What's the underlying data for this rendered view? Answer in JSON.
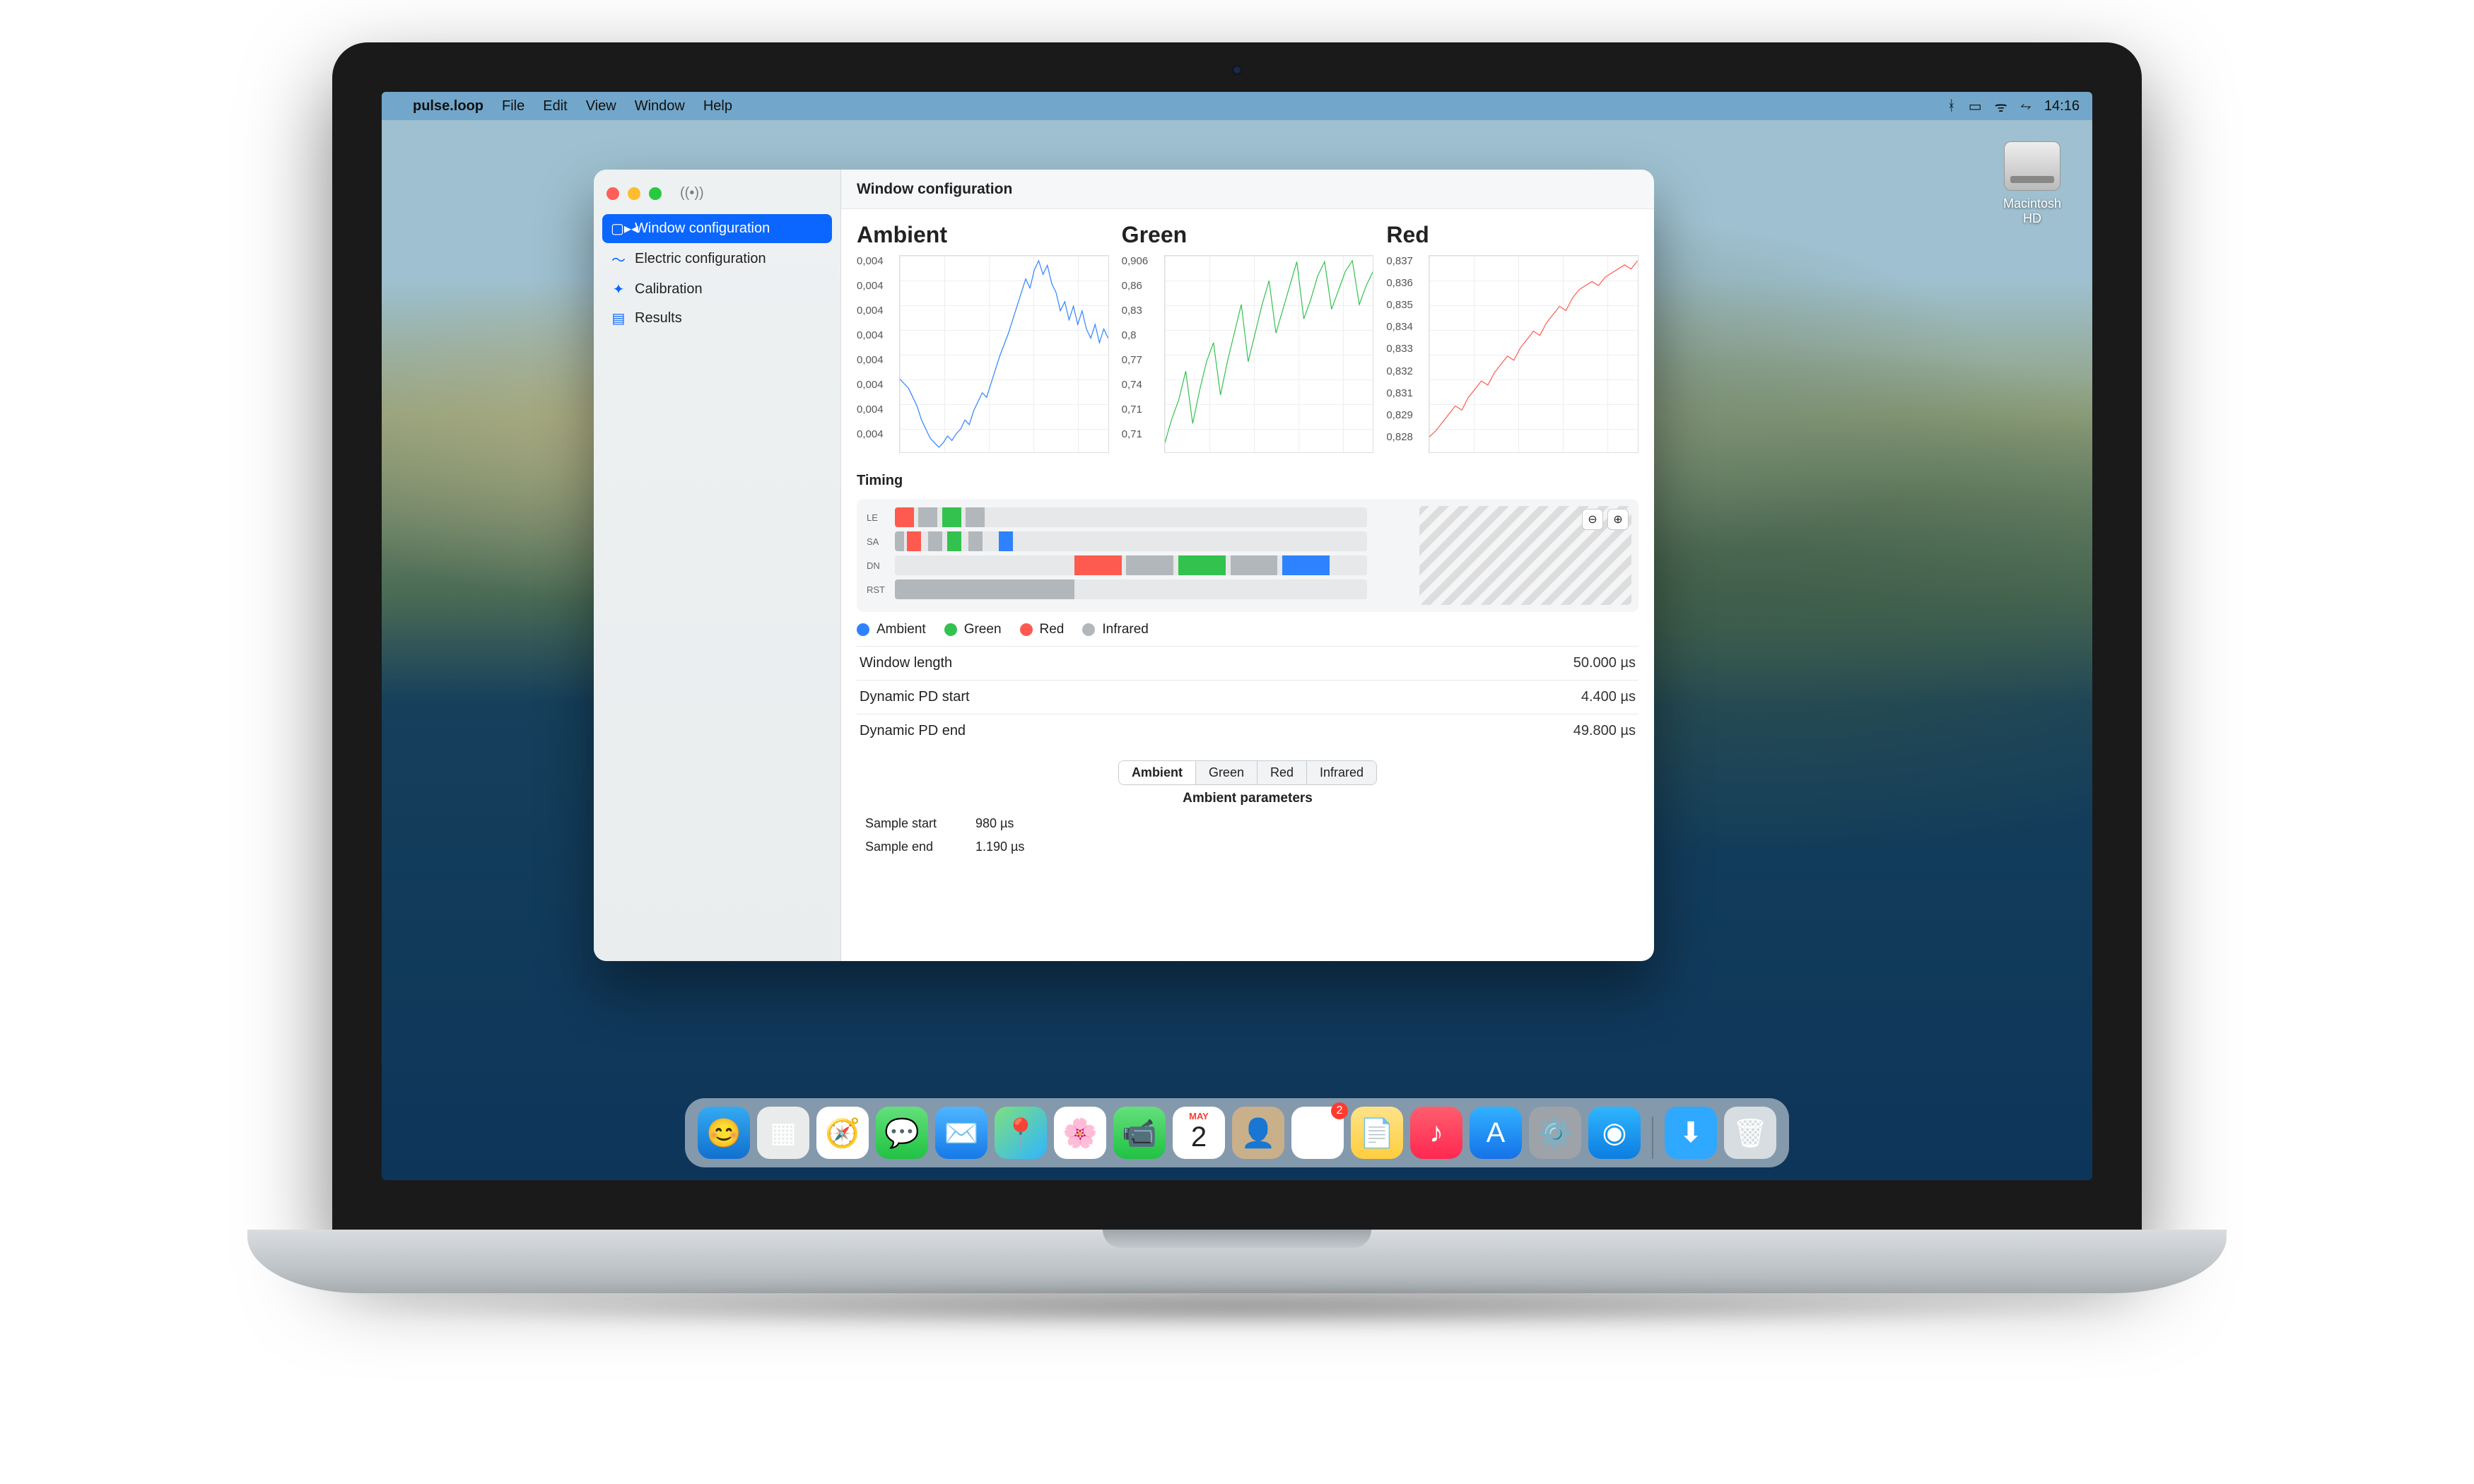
{
  "menubar": {
    "app_name": "pulse.loop",
    "items": [
      "File",
      "Edit",
      "View",
      "Window",
      "Help"
    ],
    "clock": "14:16"
  },
  "desktop": {
    "drive_label": "Macintosh HD"
  },
  "window": {
    "title": "Window configuration"
  },
  "sidebar": {
    "items": [
      {
        "label": "Window configuration",
        "selected": true
      },
      {
        "label": "Electric configuration",
        "selected": false
      },
      {
        "label": "Calibration",
        "selected": false
      },
      {
        "label": "Results",
        "selected": false
      }
    ]
  },
  "charts": {
    "ambient": {
      "title": "Ambient"
    },
    "green": {
      "title": "Green"
    },
    "red": {
      "title": "Red"
    }
  },
  "chart_data": [
    {
      "type": "line",
      "title": "Ambient",
      "color": "#2f82ff",
      "y_ticks": [
        "0,004",
        "0,004",
        "0,004",
        "0,004",
        "0,004",
        "0,004",
        "0,004",
        "0,004"
      ],
      "series": [
        {
          "name": "Ambient",
          "values": [
            0.4,
            0.38,
            0.36,
            0.32,
            0.28,
            0.22,
            0.18,
            0.14,
            0.12,
            0.1,
            0.12,
            0.15,
            0.13,
            0.16,
            0.18,
            0.22,
            0.2,
            0.26,
            0.3,
            0.34,
            0.32,
            0.38,
            0.44,
            0.5,
            0.55,
            0.6,
            0.66,
            0.72,
            0.78,
            0.84,
            0.8,
            0.88,
            0.92,
            0.86,
            0.9,
            0.82,
            0.78,
            0.7,
            0.74,
            0.66,
            0.72,
            0.64,
            0.7,
            0.62,
            0.58,
            0.64,
            0.56,
            0.62,
            0.58
          ]
        }
      ]
    },
    {
      "type": "line",
      "title": "Green",
      "color": "#33c24d",
      "y_ticks": [
        "0,906",
        "0,86",
        "0,83",
        "0,8",
        "0,77",
        "0,74",
        "0,71",
        "0,71"
      ],
      "ylim": [
        0.71,
        0.906
      ],
      "series": [
        {
          "name": "Green",
          "values": [
            0.715,
            0.74,
            0.76,
            0.79,
            0.735,
            0.77,
            0.8,
            0.82,
            0.765,
            0.8,
            0.83,
            0.86,
            0.8,
            0.83,
            0.86,
            0.885,
            0.83,
            0.855,
            0.88,
            0.905,
            0.845,
            0.865,
            0.89,
            0.905,
            0.855,
            0.875,
            0.895,
            0.906,
            0.86,
            0.88,
            0.895
          ]
        }
      ]
    },
    {
      "type": "line",
      "title": "Red",
      "color": "#ff5a4f",
      "y_ticks": [
        "0,837",
        "0,836",
        "0,835",
        "0,834",
        "0,833",
        "0,832",
        "0,831",
        "0,829",
        "0,828"
      ],
      "ylim": [
        0.828,
        0.837
      ],
      "series": [
        {
          "name": "Red",
          "values": [
            0.8285,
            0.8288,
            0.8292,
            0.8296,
            0.83,
            0.8298,
            0.8304,
            0.8308,
            0.8312,
            0.831,
            0.8316,
            0.832,
            0.8324,
            0.8322,
            0.8328,
            0.8332,
            0.8336,
            0.8334,
            0.834,
            0.8344,
            0.8348,
            0.8346,
            0.8352,
            0.8356,
            0.8358,
            0.836,
            0.8358,
            0.8362,
            0.8364,
            0.8366,
            0.8368,
            0.8366,
            0.837
          ]
        }
      ]
    }
  ],
  "timing": {
    "title": "Timing",
    "rows": [
      "LE",
      "SA",
      "DN",
      "RST"
    ],
    "legend": [
      {
        "name": "Ambient",
        "color": "#2f82ff"
      },
      {
        "name": "Green",
        "color": "#33c24d"
      },
      {
        "name": "Red",
        "color": "#ff5a4f"
      },
      {
        "name": "Infrared",
        "color": "#b2b7bb"
      }
    ],
    "kv": [
      {
        "k": "Window length",
        "v": "50.000 µs"
      },
      {
        "k": "Dynamic PD start",
        "v": "4.400 µs"
      },
      {
        "k": "Dynamic PD end",
        "v": "49.800 µs"
      }
    ],
    "tabs": [
      "Ambient",
      "Green",
      "Red",
      "Infrared"
    ],
    "active_tab": "Ambient",
    "params_title": "Ambient parameters",
    "params": [
      {
        "k": "Sample start",
        "v": "980 µs"
      },
      {
        "k": "Sample end",
        "v": "1.190 µs"
      }
    ]
  },
  "dock": {
    "apps": [
      {
        "name": "Finder",
        "bg": "linear-gradient(180deg,#34aaf1,#1170d0)",
        "glyph": "😊"
      },
      {
        "name": "Launchpad",
        "bg": "#e9eceb",
        "glyph": "▦"
      },
      {
        "name": "Safari",
        "bg": "#fff",
        "glyph": "🧭"
      },
      {
        "name": "Messages",
        "bg": "linear-gradient(180deg,#64e07c,#20c243)",
        "glyph": "💬"
      },
      {
        "name": "Mail",
        "bg": "linear-gradient(180deg,#4fb6ff,#1679e8)",
        "glyph": "✉️"
      },
      {
        "name": "Maps",
        "bg": "linear-gradient(135deg,#7ee07c,#2fb5ff)",
        "glyph": "📍"
      },
      {
        "name": "Photos",
        "bg": "#fff",
        "glyph": "🌸"
      },
      {
        "name": "FaceTime",
        "bg": "linear-gradient(180deg,#64e07c,#20c243)",
        "glyph": "📹"
      },
      {
        "name": "Calendar",
        "bg": "#fff",
        "glyph": "",
        "text_top": "MAY",
        "text_main": "2"
      },
      {
        "name": "Contacts",
        "bg": "#c9b08a",
        "glyph": "👤"
      },
      {
        "name": "Reminders",
        "bg": "#fff",
        "glyph": "☰",
        "badge": "2"
      },
      {
        "name": "Notes",
        "bg": "linear-gradient(180deg,#ffe38a,#ffce3d)",
        "glyph": "📄"
      },
      {
        "name": "Music",
        "bg": "linear-gradient(180deg,#ff5d6e,#ff2851)",
        "glyph": "♪"
      },
      {
        "name": "AppStore",
        "bg": "linear-gradient(180deg,#32b1ff,#1572e8)",
        "glyph": "A"
      },
      {
        "name": "Settings",
        "bg": "#9da3a9",
        "glyph": "⚙️"
      },
      {
        "name": "ScreenSharing",
        "bg": "linear-gradient(180deg,#2fb6ff,#0c7de0)",
        "glyph": "◉"
      }
    ],
    "right": [
      {
        "name": "Downloads",
        "bg": "#2fa8ff",
        "glyph": "⬇︎"
      },
      {
        "name": "Trash",
        "bg": "#d7dde0",
        "glyph": "🗑"
      }
    ]
  }
}
